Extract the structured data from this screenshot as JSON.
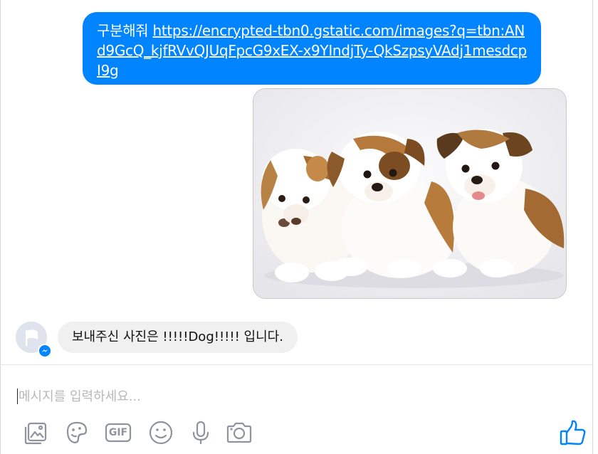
{
  "conversation": {
    "outgoing_message": {
      "text": "구분해줘 ",
      "link": "https://encrypted-tbn0.gstatic.com/images?q=tbn:ANd9GcQ_kjfRVvQJUqFpcG9xEX-x9YIndjTy-QkSzpsyVAdj1mesdcpI9g"
    },
    "image_attachment": {
      "alt_icon": "puppies-photo"
    },
    "incoming_message": {
      "text": "보내주신 사진은 !!!!!Dog!!!!! 입니다."
    }
  },
  "composer": {
    "placeholder": "메시지를 입력하세요..."
  },
  "toolbar": {
    "gif_label": "GIF"
  },
  "colors": {
    "accent": "#0084ff",
    "incoming_bubble": "#f0f0f0",
    "icon_gray": "#8d949e"
  }
}
